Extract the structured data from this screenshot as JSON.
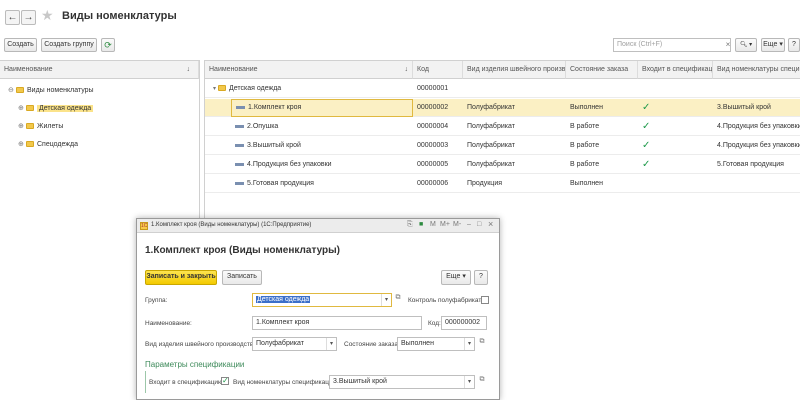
{
  "window": {
    "title": "Виды номенклатуры",
    "back_glyph": "←",
    "forward_glyph": "→",
    "star_glyph": "★"
  },
  "toolbar": {
    "create_label": "Создать",
    "create_group_label": "Создать группу",
    "refresh_glyph": "⟳",
    "search_placeholder": "Поиск (Ctrl+F)",
    "clear_glyph": "×",
    "search_glyph": "🔍︎ ▾",
    "more_label": "Еще ▾",
    "help_label": "?"
  },
  "tree": {
    "header": "Наименование",
    "sort_glyph": "↓",
    "root": "Виды номенклатуры",
    "items": [
      {
        "label": "Детская одежда",
        "selected": true
      },
      {
        "label": "Жилеты",
        "selected": false
      },
      {
        "label": "Спецодежда",
        "selected": false
      }
    ]
  },
  "table": {
    "columns": [
      "Наименование",
      "Код",
      "Вид изделия швейного произво...",
      "Состояние заказа",
      "Входит в спецификацию",
      "Вид номенклатуры специфи..."
    ],
    "sort_glyph": "↓",
    "group_row": {
      "name": "Детская одежда",
      "code": "00000001"
    },
    "rows": [
      {
        "name": "1.Комплект кроя",
        "code": "00000002",
        "kind": "Полуфабрикат",
        "state": "Выполнен",
        "in_spec": "✓",
        "spec_kind": "3.Вышитый крой"
      },
      {
        "name": "2.Опушка",
        "code": "00000004",
        "kind": "Полуфабрикат",
        "state": "В работе",
        "in_spec": "✓",
        "spec_kind": "4.Продукция без упаковки"
      },
      {
        "name": "3.Вышитый крой",
        "code": "00000003",
        "kind": "Полуфабрикат",
        "state": "В работе",
        "in_spec": "✓",
        "spec_kind": "4.Продукция без упаковки"
      },
      {
        "name": "4.Продукция без упаковки",
        "code": "00000005",
        "kind": "Полуфабрикат",
        "state": "В работе",
        "in_spec": "✓",
        "spec_kind": "5.Готовая продукция"
      },
      {
        "name": "5.Готовая продукция",
        "code": "00000006",
        "kind": "Продукция",
        "state": "Выполнен",
        "in_spec": "",
        "spec_kind": ""
      }
    ]
  },
  "dialog": {
    "window_title": "1.Комплект кроя (Виды номенклатуры) (1С:Предприятие)",
    "logo_text": "1С",
    "tools": {
      "doc": "⎘",
      "m": "M",
      "mplus": "M+",
      "mminus": "M-",
      "min": "–",
      "max": "□",
      "close": "×"
    },
    "heading": "1.Комплект кроя (Виды номенклатуры)",
    "save_close_label": "Записать и закрыть",
    "save_label": "Записать",
    "more_label": "Еще ▾",
    "help_label": "?",
    "group_label": "Группа:",
    "group_value": "Детская одежда",
    "dropdown_glyph": "▾",
    "link_glyph": "⧉",
    "semi_control_label": "Контроль полуфабриката:",
    "name_label": "Наименование:",
    "name_value": "1.Комплект кроя",
    "code_label": "Код:",
    "code_value": "000000002",
    "kind_label": "Вид изделия швейного производства:",
    "kind_value": "Полуфабрикат",
    "state_label": "Состояние заказа:",
    "state_value": "Выполнен",
    "spec_section": "Параметры спецификации",
    "in_spec_label": "Входит в спецификацию:",
    "in_spec_check": "✓",
    "spec_kind_label": "Вид номенклатуры спецификации:",
    "spec_kind_value": "3.Вышитый крой"
  }
}
